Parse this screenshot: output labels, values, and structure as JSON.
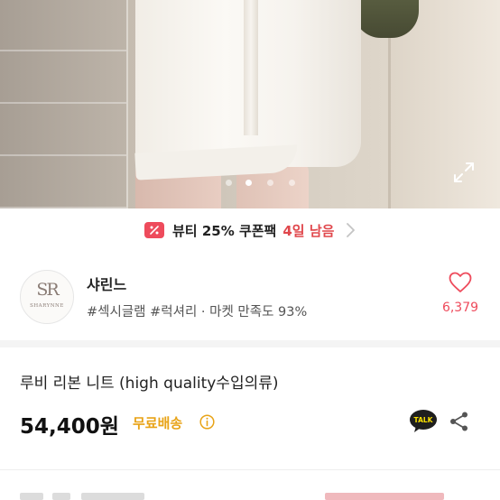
{
  "gallery": {
    "image_count": 4,
    "active_index": 1
  },
  "coupon": {
    "icon": "coupon-icon",
    "text": "뷰티 25% 쿠폰팩",
    "time_left": "4일 남음",
    "accent_color": "#e0474c"
  },
  "shop": {
    "avatar_text": "SR",
    "avatar_name": "SHARYNNE",
    "name": "샤린느",
    "tags": "#섹시글램 #럭셔리 · 마켓 만족도 93%",
    "like_count": "6,379",
    "heart_color": "#ee4b5c"
  },
  "product": {
    "title": "루비 리본 니트 (high quality수입의류)",
    "price": "54,400원",
    "shipping": "무료배송",
    "shipping_color": "#e8a317"
  },
  "actions": {
    "talk_label": "TALK"
  }
}
